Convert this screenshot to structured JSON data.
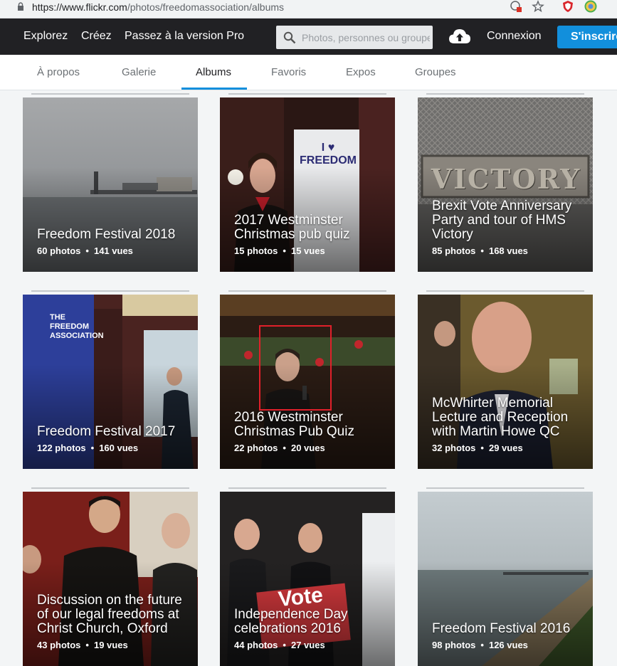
{
  "browser": {
    "url_domain": "https://www.flickr.com",
    "url_path": "/photos/freedomassociation/albums"
  },
  "nav": {
    "explore": "Explorez",
    "create": "Créez",
    "pro": "Passez à la version Pro",
    "search_placeholder": "Photos, personnes ou groupes",
    "login": "Connexion",
    "signup": "S'inscrire"
  },
  "tabs": [
    "À propos",
    "Galerie",
    "Albums",
    "Favoris",
    "Expos",
    "Groupes"
  ],
  "active_tab": "Albums",
  "albums": [
    {
      "title": "Freedom Festival 2018",
      "photos": "60 photos",
      "views": "141 vues"
    },
    {
      "title": "2017 Westminster Christmas pub quiz",
      "photos": "15 photos",
      "views": "15 vues"
    },
    {
      "title": "Brexit Vote Anniversary Party and tour of HMS Victory",
      "photos": "85 photos",
      "views": "168 vues"
    },
    {
      "title": "Freedom Festival 2017",
      "photos": "122 photos",
      "views": "160 vues"
    },
    {
      "title": "2016 Westminster Christmas Pub Quiz",
      "photos": "22 photos",
      "views": "20 vues"
    },
    {
      "title": "McWhirter Memorial Lecture and Reception with Martin Howe QC",
      "photos": "32 photos",
      "views": "29 vues"
    },
    {
      "title": "Discussion on the future of our legal freedoms at Christ Church, Oxford",
      "photos": "43 photos",
      "views": "19 vues"
    },
    {
      "title": "Independence Day celebrations 2016",
      "photos": "44 photos",
      "views": "27 vues"
    },
    {
      "title": "Freedom Festival 2016",
      "photos": "98 photos",
      "views": "126 vues"
    }
  ],
  "cover_text": {
    "banner_heart": "I ♥ FREEDOM",
    "victory_sign": "VICTORY",
    "banner_tfa": "THE FREEDOM ASSOCIATION",
    "vote_sign": "Vote"
  },
  "colors": {
    "nav_bg": "#212124",
    "accent": "#128fdc"
  }
}
